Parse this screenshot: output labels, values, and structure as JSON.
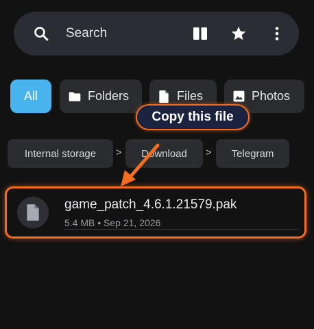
{
  "search": {
    "placeholder": "Search"
  },
  "filters": [
    {
      "label": "All",
      "active": true
    },
    {
      "label": "Folders",
      "icon": "folder-icon"
    },
    {
      "label": "Files",
      "icon": "file-icon"
    },
    {
      "label": "Photos",
      "icon": "photo-icon"
    }
  ],
  "breadcrumbs": [
    "Internal storage",
    "Download",
    "Telegram"
  ],
  "breadcrumb_separator": ">",
  "callout": {
    "text": "Copy this file"
  },
  "file": {
    "name": "game_patch_4.6.1.21579.pak",
    "meta": "5.4 MB • Sep 21, 2026",
    "icon": "document-icon"
  },
  "colors": {
    "background": "#121212",
    "accent": "#48b3ec",
    "highlight": "#f36d21"
  }
}
